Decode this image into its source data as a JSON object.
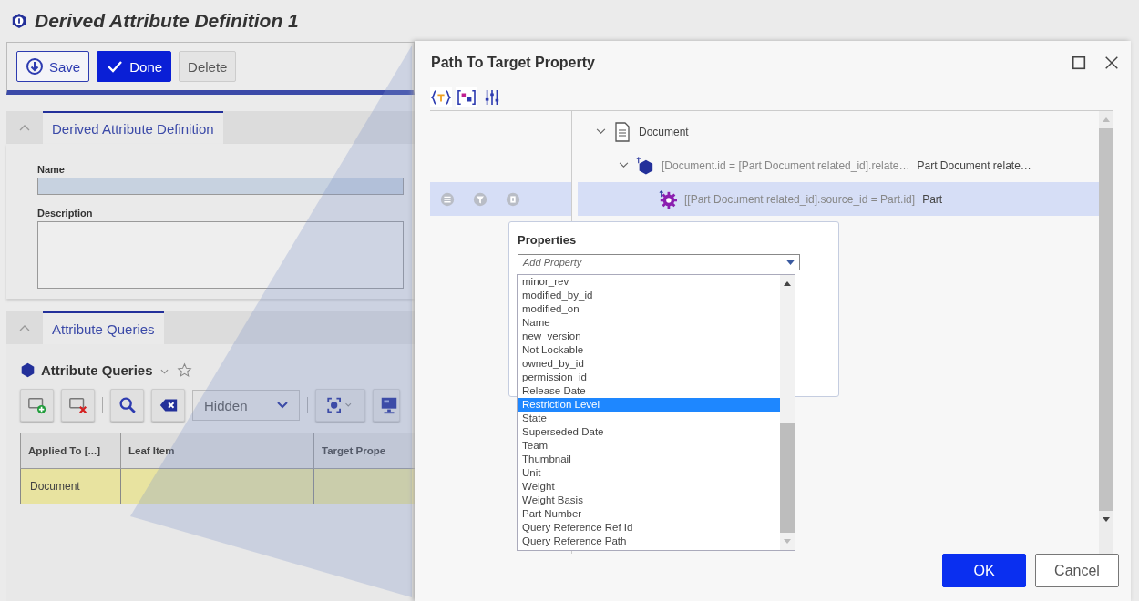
{
  "page": {
    "title": "Derived Attribute Definition 1",
    "actions": [
      {
        "label": "Save",
        "kind": "save"
      },
      {
        "label": "Done",
        "kind": "done"
      },
      {
        "label": "Delete",
        "kind": "plain"
      }
    ],
    "definition_section": {
      "tab": {
        "label": "Derived Attribute Definition",
        "selected": true
      },
      "fields": [
        {
          "label": "Name",
          "kind": "input"
        },
        {
          "label": "Description",
          "kind": "textarea"
        }
      ]
    },
    "queries_section": {
      "tab": {
        "label": "Attribute Queries",
        "selected": true
      },
      "grid_title": "Attribute Queries",
      "filter": {
        "value": "Hidden"
      },
      "table": {
        "columns": [
          "Applied To [...]",
          "Leaf Item",
          "Target Prope"
        ],
        "rows": [
          {
            "cells": [
              "Document"
            ],
            "selected": true
          }
        ]
      }
    }
  },
  "dialog": {
    "title": "Path To Target Property",
    "tree": [
      {
        "label": "Document",
        "kind": "document",
        "expanded": true,
        "selected": false,
        "children": [
          {
            "condition": "[Document.id = [Part Document related_id].relate…",
            "label": "Part Document relate…",
            "kind": "relationship",
            "expanded": true,
            "selected": false,
            "children": [
              {
                "condition": "[[Part Document related_id].source_id = Part.id]",
                "label": "Part",
                "kind": "item",
                "selected": true
              }
            ]
          }
        ]
      }
    ],
    "properties": {
      "title": "Properties",
      "placeholder": "Add Property",
      "options": [
        {
          "label": "minor_rev",
          "selected": false
        },
        {
          "label": "modified_by_id",
          "selected": false
        },
        {
          "label": "modified_on",
          "selected": false
        },
        {
          "label": "Name",
          "selected": false
        },
        {
          "label": "new_version",
          "selected": false
        },
        {
          "label": "Not Lockable",
          "selected": false
        },
        {
          "label": "owned_by_id",
          "selected": false
        },
        {
          "label": "permission_id",
          "selected": false
        },
        {
          "label": "Release Date",
          "selected": false
        },
        {
          "label": "Restriction Level",
          "selected": true
        },
        {
          "label": "State",
          "selected": false
        },
        {
          "label": "Superseded Date",
          "selected": false
        },
        {
          "label": "Team",
          "selected": false
        },
        {
          "label": "Thumbnail",
          "selected": false
        },
        {
          "label": "Unit",
          "selected": false
        },
        {
          "label": "Weight",
          "selected": false
        },
        {
          "label": "Weight Basis",
          "selected": false
        },
        {
          "label": "Part Number",
          "selected": false
        },
        {
          "label": "Query Reference Ref Id",
          "selected": false
        },
        {
          "label": "Query Reference Path",
          "selected": false
        }
      ]
    },
    "buttons": [
      {
        "label": "OK",
        "kind": "primary"
      },
      {
        "label": "Cancel",
        "kind": "secondary"
      }
    ]
  }
}
